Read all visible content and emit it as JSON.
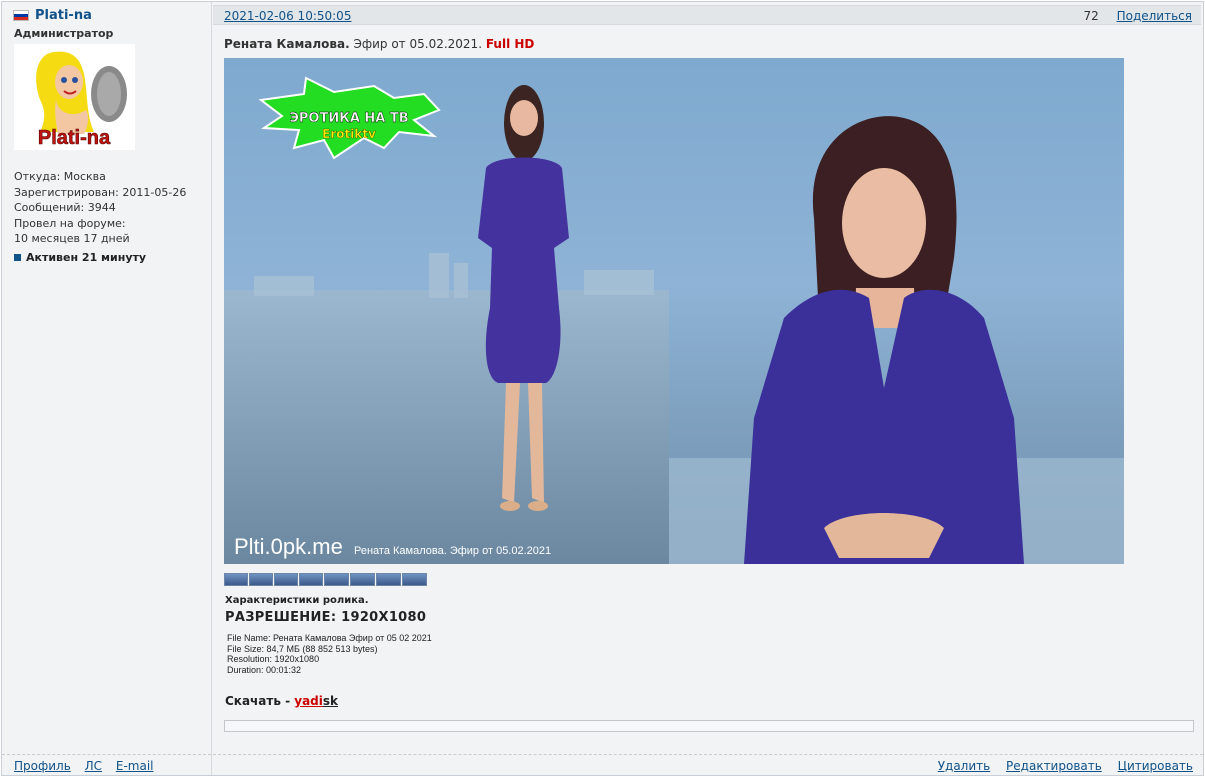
{
  "author": {
    "username": "Plati-na",
    "rank": "Администратор",
    "avatar_text": "Plati-na",
    "location": "Откуда: Москва",
    "registered": "Зарегистрирован: 2011-05-26",
    "posts": "Сообщений: 3944",
    "time_label": "Провел на форуме:",
    "time_value": "10 месяцев 17 дней",
    "status": "Активен 21 минуту",
    "links": {
      "profile": "Профиль",
      "pm": "ЛС",
      "email": "E-mail"
    }
  },
  "post": {
    "datetime": "2021-02-06 10:50:05",
    "views": "72",
    "share": "Поделиться",
    "title_bold": "Рената Камалова.",
    "title_text": " Эфир от 05.02.2021. ",
    "title_hd": "Full HD",
    "image": {
      "logo_line1": "ЭРОТИКА НА ТВ",
      "logo_line2": "Erotiktv",
      "watermark": "Plti.0pk.me",
      "caption": "Рената Камалова. Эфир от 05.02.2021"
    },
    "characteristics": "Характеристики ролика.",
    "resolution": "РАЗРЕШЕНИЕ: 1920Х1080",
    "mediainfo": {
      "file_name": "File Name: Рената Камалова Эфир от 05 02 2021",
      "file_size": "File Size: 84,7 МБ (88 852 513 bytes)",
      "resolution": "Resolution: 1920x1080",
      "duration": "Duration: 00:01:32"
    },
    "download_label": "Скачать - ",
    "download_red": "yadi",
    "download_dark": "sk",
    "actions": {
      "delete": "Удалить",
      "edit": "Редактировать",
      "quote": "Цитировать"
    }
  }
}
